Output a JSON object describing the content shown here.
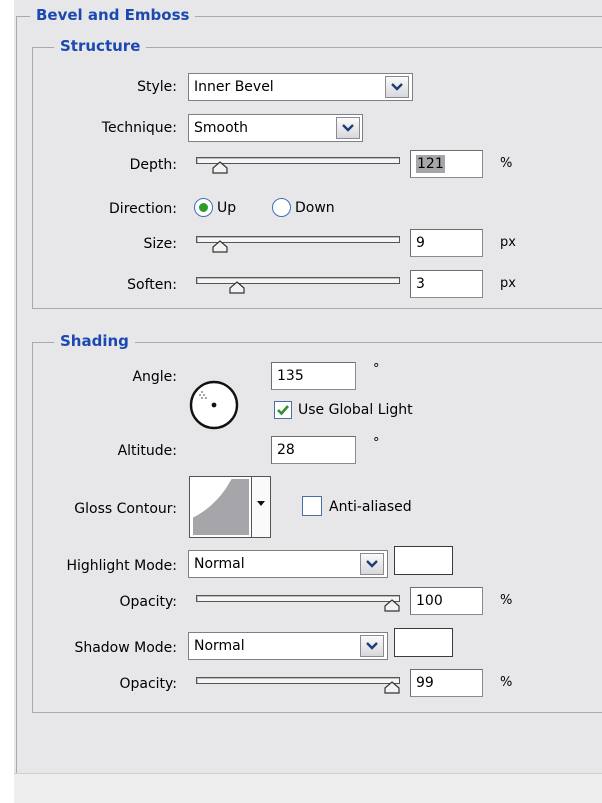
{
  "bevel": {
    "title": "Bevel and Emboss",
    "structure": {
      "title": "Structure",
      "style_label": "Style:",
      "style_value": "Inner Bevel",
      "technique_label": "Technique:",
      "technique_value": "Smooth",
      "depth_label": "Depth:",
      "depth_value": "121",
      "depth_unit": "%",
      "depth_level": 0.12,
      "direction_label": "Direction:",
      "direction_up": "Up",
      "direction_down": "Down",
      "direction_selected": "Up",
      "size_label": "Size:",
      "size_value": "9",
      "size_unit": "px",
      "size_level": 0.12,
      "soften_label": "Soften:",
      "soften_value": "3",
      "soften_unit": "px",
      "soften_level": 0.2
    },
    "shading": {
      "title": "Shading",
      "angle_label": "Angle:",
      "angle_value": "135",
      "angle_unit": "°",
      "use_global_light": "Use Global Light",
      "use_global_light_checked": true,
      "altitude_label": "Altitude:",
      "altitude_value": "28",
      "altitude_unit": "°",
      "gloss_label": "Gloss Contour:",
      "anti_aliased": "Anti-aliased",
      "anti_aliased_checked": false,
      "highlight_mode_label": "Highlight Mode:",
      "highlight_mode_value": "Normal",
      "highlight_color": "#ffffff",
      "highlight_opacity_label": "Opacity:",
      "highlight_opacity_value": "100",
      "highlight_opacity_unit": "%",
      "highlight_opacity_level": 1.0,
      "shadow_mode_label": "Shadow Mode:",
      "shadow_mode_value": "Normal",
      "shadow_color": "#ffffff",
      "shadow_opacity_label": "Opacity:",
      "shadow_opacity_value": "99",
      "shadow_opacity_unit": "%",
      "shadow_opacity_level": 0.99
    }
  },
  "colors": {
    "panel": "#e7e7ea",
    "legend_text": "#1c49b0",
    "radio_selected": "#2f9a2f",
    "checkbox_check": "#2f8f2f"
  },
  "icons": {
    "dropdown": "chevron-down-icon",
    "angle_dial": "angle-dial-icon",
    "contour": "gloss-contour-icon",
    "slider_thumb": "slider-thumb-icon"
  }
}
